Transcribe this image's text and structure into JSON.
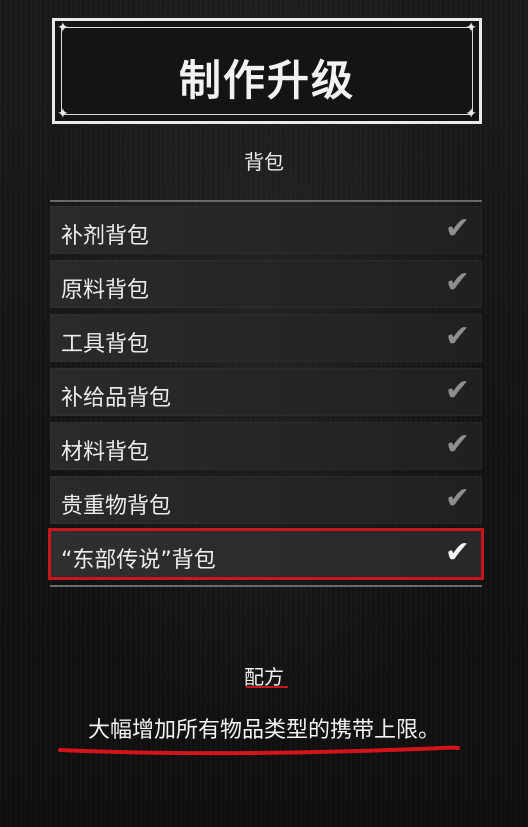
{
  "header": {
    "title": "制作升级"
  },
  "section": {
    "title": "背包"
  },
  "upgrades": [
    {
      "label": "补剂背包",
      "checked": true,
      "selected": false
    },
    {
      "label": "原料背包",
      "checked": true,
      "selected": false
    },
    {
      "label": "工具背包",
      "checked": true,
      "selected": false
    },
    {
      "label": "补给品背包",
      "checked": true,
      "selected": false
    },
    {
      "label": "材料背包",
      "checked": true,
      "selected": false
    },
    {
      "label": "贵重物背包",
      "checked": true,
      "selected": false
    },
    {
      "label": "“东部传说”背包",
      "checked": true,
      "selected": true
    }
  ],
  "details": {
    "recipe_label": "配方",
    "description": "大幅增加所有物品类型的携带上限。"
  },
  "icons": {
    "check": "checkmark-icon",
    "frame_ornament": "ornament-icon"
  },
  "colors": {
    "highlight": "#c7161d",
    "text": "#ececec",
    "check_inactive": "#8e8e8e"
  }
}
